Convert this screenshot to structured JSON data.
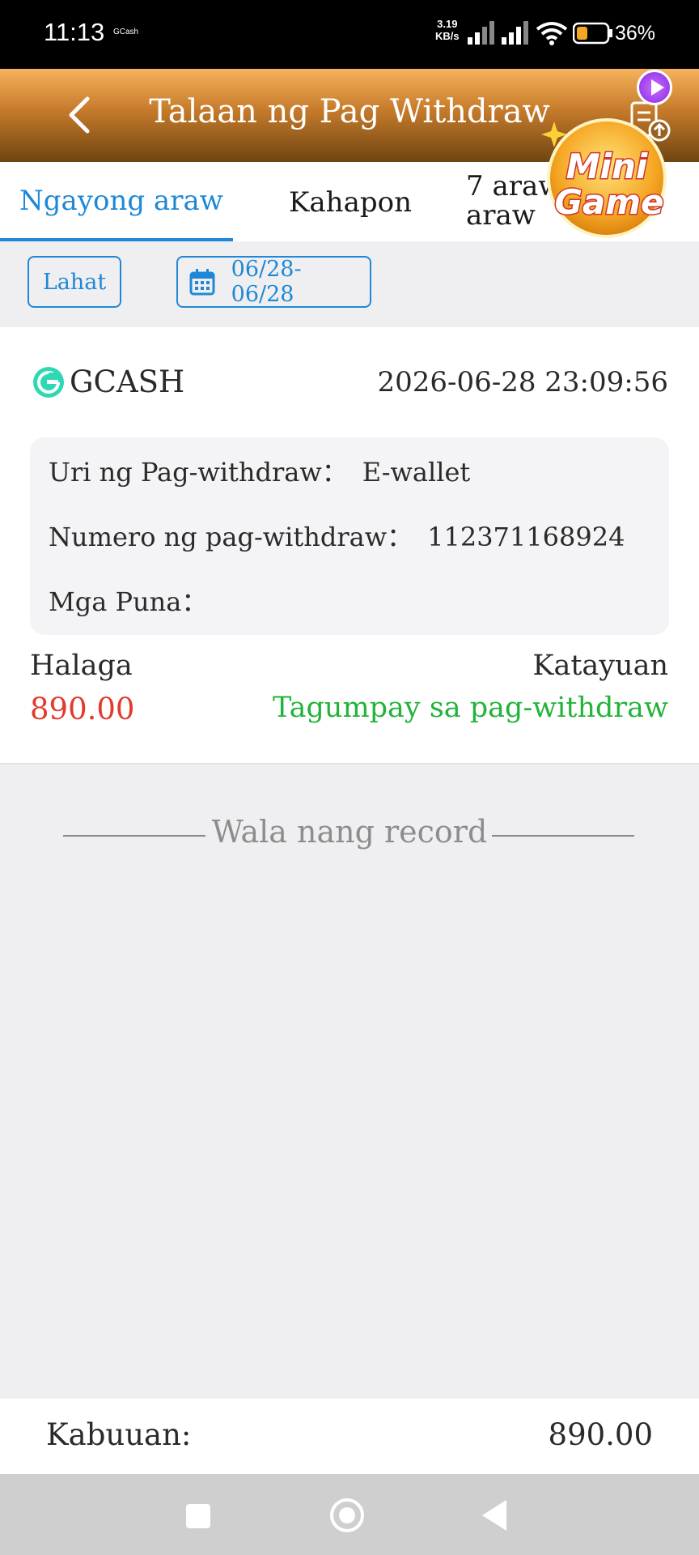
{
  "status_bar": {
    "time": "11:13",
    "app_tag": "GCash",
    "net_speed_value": "3.19",
    "net_speed_unit": "KB/s",
    "battery_percent": "36%",
    "battery_color": "#f5a623"
  },
  "header": {
    "title": "Talaan ng Pag Withdraw",
    "back_icon": "chevron-left-icon",
    "export_icon": "document-upload-icon",
    "bg_color": "#c57a2a"
  },
  "tabs": [
    {
      "label": "Ngayong araw",
      "active": true
    },
    {
      "label": "Kahapon",
      "active": false
    },
    {
      "label_line1": "7 araw",
      "label_line2": "araw",
      "active": false
    }
  ],
  "filters": {
    "all_label": "Lahat",
    "date_range": "06/28- 06/28",
    "date_icon": "calendar-icon"
  },
  "record": {
    "wallet": "GCASH",
    "date": "2026-06-28 23:09:56",
    "type_label": "Uri ng Pag-withdraw：",
    "type_value": "E-wallet",
    "number_label": "Numero ng pag-withdraw：",
    "number_value": "112371168924",
    "remarks_label": "Mga Puna：",
    "remarks_value": "",
    "amount_label": "Halaga",
    "amount_value": "890.00",
    "status_label": "Katayuan",
    "status_value": "Tagumpay sa pag-withdraw",
    "amount_color": "#e23a2c",
    "status_color": "#22b33a"
  },
  "no_more": "Wala nang record",
  "total": {
    "label": "Kabuuan:",
    "value": "890.00"
  },
  "floating": {
    "line1": "Mini",
    "line2": "Game",
    "play_icon": "play-icon"
  },
  "accent_color": "#1f88d6"
}
